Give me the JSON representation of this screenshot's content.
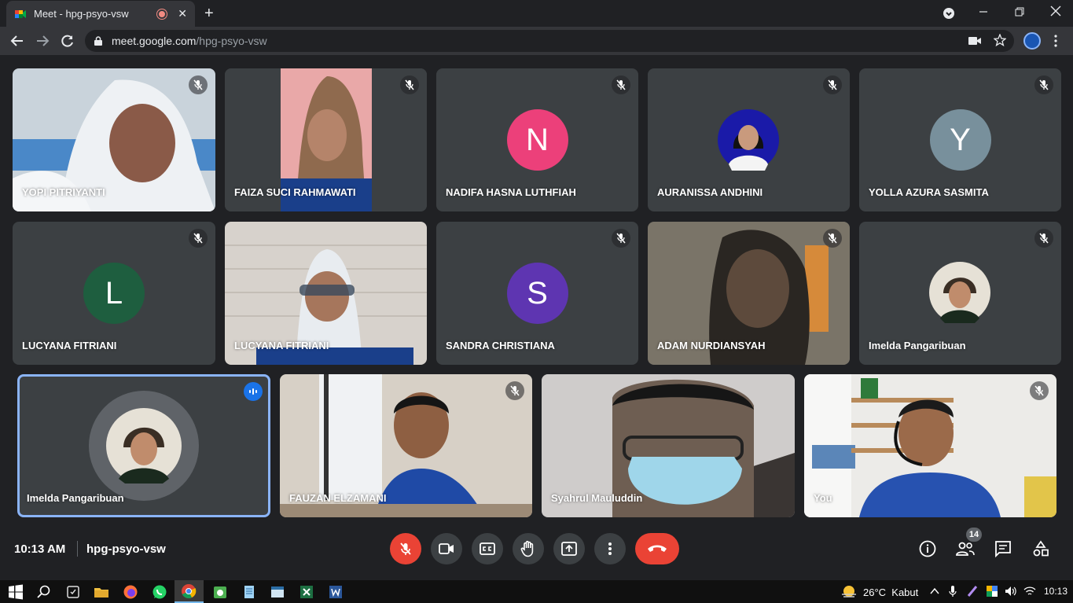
{
  "browser": {
    "tab_title": "Meet - hpg-psyo-vsw",
    "tab_close": "✕",
    "new_tab": "+",
    "url_host": "meet.google.com",
    "url_path": "/hpg-psyo-vsw"
  },
  "tiles": [
    {
      "name": "YOPI PITRIYANTI",
      "kind": "video"
    },
    {
      "name": "FAIZA SUCI RAHMAWATI",
      "kind": "video"
    },
    {
      "name": "NADIFA HASNA LUTHFIAH",
      "kind": "initial",
      "initial": "N",
      "color": "#ec407a"
    },
    {
      "name": "AURANISSA ANDHINI",
      "kind": "photo"
    },
    {
      "name": "YOLLA AZURA SASMITA",
      "kind": "initial",
      "initial": "Y",
      "color": "#78909c"
    },
    {
      "name": "LUCYANA FITRIANI",
      "kind": "initial",
      "initial": "L",
      "color": "#1e5e3f"
    },
    {
      "name": "LUCYANA FITRIANI",
      "kind": "video"
    },
    {
      "name": "SANDRA CHRISTIANA",
      "kind": "initial",
      "initial": "S",
      "color": "#5e35b1"
    },
    {
      "name": "ADAM NURDIANSYAH",
      "kind": "video"
    },
    {
      "name": "Imelda Pangaribuan",
      "kind": "photo"
    },
    {
      "name": "Imelda Pangaribuan",
      "kind": "speaking-photo"
    },
    {
      "name": "FAUZAN ELZAMANI",
      "kind": "video"
    },
    {
      "name": "Syahrul Mauluddin",
      "kind": "video"
    },
    {
      "name": "You",
      "kind": "video"
    }
  ],
  "meeting": {
    "time": "10:13 AM",
    "code": "hpg-psyo-vsw",
    "participant_count": "14"
  },
  "taskbar": {
    "temperature": "26°C",
    "weather": "Kabut",
    "time": "10:13"
  },
  "colors": {
    "meet_red": "#ea4335",
    "speaking_blue": "#1a73e8",
    "tile_bg": "#3c4043"
  }
}
